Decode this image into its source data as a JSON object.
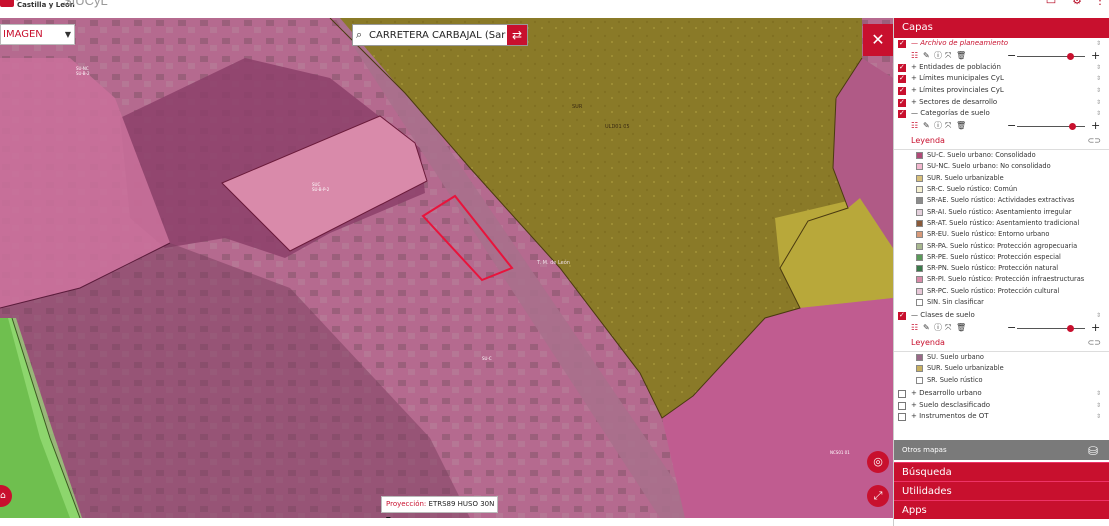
{
  "header": {
    "logo_text": "Junta de\nCastilla y León",
    "app_title": "SIUCyL"
  },
  "map": {
    "base_layer": "IMAGEN",
    "search": {
      "value": "CARRETERA CARBAJAL (Sar"
    },
    "projection": {
      "label": "Proyección:",
      "value": "ETRS89 HUSO 30N"
    },
    "labels": {
      "sur": "SUR",
      "sector_code": "ULD01 05",
      "road": "T. M. de León",
      "block_upper": "SUC\nSU-B-P-2",
      "block_left": "SU-NC\nSU-B-2",
      "block_center": "SU-C",
      "corner": "NCS01 01"
    },
    "colors": {
      "suelo_urbano": "#e04f8c",
      "urbanizable": "#9a8a28",
      "rustico": "#6fbf4f",
      "selection": "#e8143c"
    }
  },
  "panel": {
    "title": "Capas",
    "layers": {
      "archivo": "Archivo de planeamiento",
      "entidades": "Entidades de población",
      "limites_municipales": "Límites municipales CyL",
      "limites_provinciales": "Límites provinciales CyL",
      "sectores": "Sectores de desarrollo",
      "categorias": "Categorías de suelo",
      "clases": "Clases de suelo",
      "desarrollo": "Desarrollo urbano",
      "desclasificado": "Suelo desclasificado",
      "instrumentos": "Instrumentos de OT"
    },
    "leyenda_label": "Leyenda",
    "legend_categorias": [
      {
        "text": "SU-C. Suelo urbano: Consolidado",
        "color": "#b04a78"
      },
      {
        "text": "SU-NC. Suelo urbano: No consolidado",
        "color": "#f2b8cf"
      },
      {
        "text": "SUR. Suelo urbanizable",
        "color": "#d8c07a"
      },
      {
        "text": "SR-C. Suelo rústico: Común",
        "color": "#f5f0d0"
      },
      {
        "text": "SR-AE. Suelo rústico: Actividades extractivas",
        "color": "#8c8c8c"
      },
      {
        "text": "SR-AI. Suelo rústico: Asentamiento irregular",
        "color": "#e4d0dc"
      },
      {
        "text": "SR-AT. Suelo rústico: Asentamiento tradicional",
        "color": "#8a5a3a"
      },
      {
        "text": "SR-EU. Suelo rústico: Entorno urbano",
        "color": "#d89a7a"
      },
      {
        "text": "SR-PA. Suelo rústico: Protección agropecuaria",
        "color": "#a8b890"
      },
      {
        "text": "SR-PE. Suelo rústico: Protección especial",
        "color": "#5a9a5a"
      },
      {
        "text": "SR-PN. Suelo rústico: Protección natural",
        "color": "#3a7a4a"
      },
      {
        "text": "SR-PI. Suelo rústico: Protección infraestructuras",
        "color": "#d88aa8"
      },
      {
        "text": "SR-PC. Suelo rústico: Protección cultural",
        "color": "#e8c8d8"
      },
      {
        "text": "SIN. Sin clasificar",
        "color": "#ffffff"
      }
    ],
    "legend_clases": [
      {
        "text": "SU. Suelo urbano",
        "color": "#9a6a88"
      },
      {
        "text": "SUR. Suelo urbanizable",
        "color": "#c8b060"
      },
      {
        "text": "SR. Suelo rústico",
        "color": "#ffffff"
      }
    ],
    "otros_mapas": "Otros mapas",
    "busqueda": "Búsqueda",
    "utilidades": "Utilidades",
    "apps": "Apps"
  }
}
